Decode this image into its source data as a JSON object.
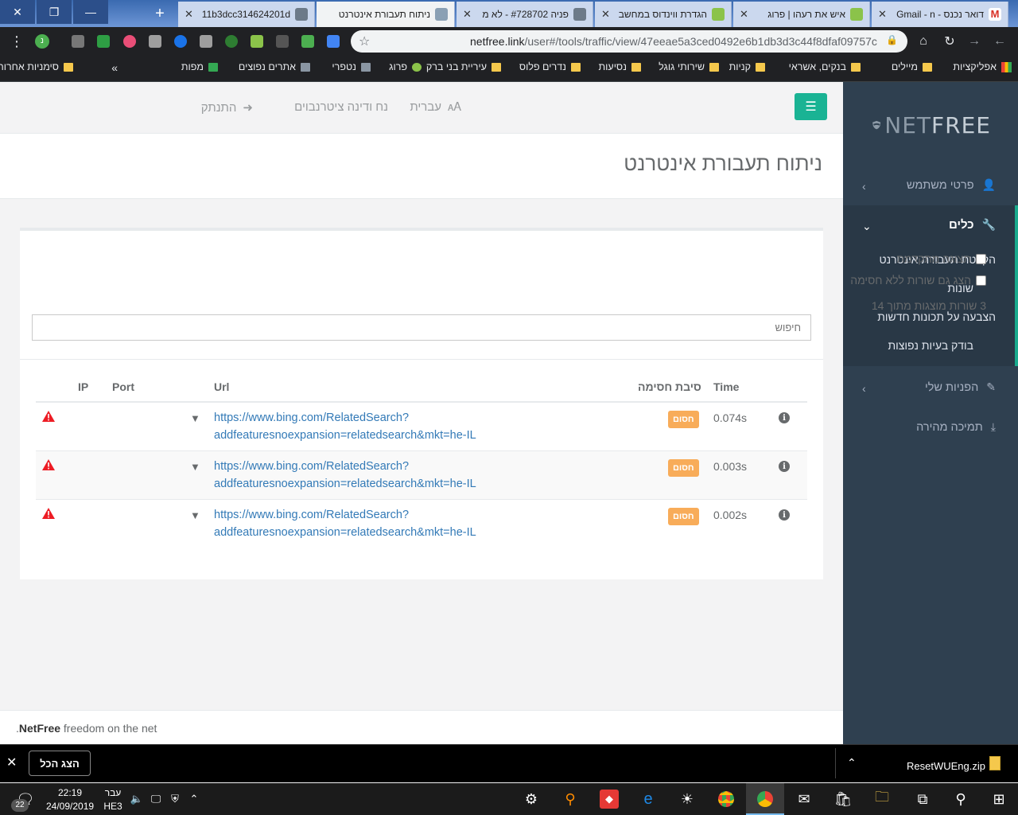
{
  "browser": {
    "tabs": [
      {
        "title": "11b3dcc314624201d",
        "active": false
      },
      {
        "title": "ניתוח תעבורת אינטרנט",
        "active": true
      },
      {
        "title": "פניה #728702 - לא מ",
        "active": false
      },
      {
        "title": "הגדרת ווינדוס במחשב",
        "active": false
      },
      {
        "title": "איש את רעהו | פרוג",
        "active": false
      },
      {
        "title": "דואר נכנס - Gmail - n",
        "active": false
      }
    ],
    "url_host": "netfree.link",
    "url_path": "/user#/tools/traffic/view/47eeae5a3ced0492e6b1db3d3c44f8dfaf09757c",
    "bookmarks": [
      "אפליקציות",
      "מיילים",
      "בנקים, אשראי",
      "קניות",
      "שירותי גוגל",
      "נסיעות",
      "נדרים פלוס",
      "עיריית בני ברק",
      "פרוג",
      "נטפרי",
      "אתרים נפוצים",
      "מפות"
    ],
    "bookmarks_overflow": "»",
    "other_bookmarks": "סימניות אחרות"
  },
  "sidebar": {
    "logo_net": "NET",
    "logo_free": "FREE",
    "items": [
      {
        "label": "פרטי משתמש"
      },
      {
        "label": "כלים"
      },
      {
        "label": "הפניות שלי"
      },
      {
        "label": "תמיכה מהירה"
      }
    ],
    "sub_items": [
      "הקלטת תעבורת אינטרנט",
      "שונות",
      "הצבעה על תכונות חדשות",
      "בודק בעיות נפוצות"
    ]
  },
  "topnav": {
    "language": "עברית",
    "user": "נח ודינה ציטרנבוים",
    "logout": "התנתק"
  },
  "page": {
    "title": "ניתוח תעבורת אינטרנט",
    "advanced_view": "תצוגה מתקדמת",
    "show_unblocked": "הצג גם שורות ללא חסימה",
    "rows_count": "3 שורות מוצגות מתוך 14",
    "search_placeholder": "חיפוש",
    "columns": {
      "time": "Time",
      "reason": "סיבת חסימה",
      "url": "Url",
      "port": "Port",
      "ip": "IP"
    },
    "rows": [
      {
        "time": "0.074s",
        "reason": "חסום",
        "url_line1": "https://www.bing.com/RelatedSearch?",
        "url_line2": "addfeaturesnoexpansion=relatedsearch&mkt=he-IL"
      },
      {
        "time": "0.003s",
        "reason": "חסום",
        "url_line1": "https://www.bing.com/RelatedSearch?",
        "url_line2": "addfeaturesnoexpansion=relatedsearch&mkt=he-IL"
      },
      {
        "time": "0.002s",
        "reason": "חסום",
        "url_line1": "https://www.bing.com/RelatedSearch?",
        "url_line2": "addfeaturesnoexpansion=relatedsearch&mkt=he-IL"
      }
    ]
  },
  "footer": {
    "brand": "NetFree",
    "tagline": "freedom on the net",
    "dot": "."
  },
  "downloads": {
    "show_all": "הצג הכל",
    "file": "ResetWUEng.zip"
  },
  "taskbar": {
    "time": "22:19",
    "date": "24/09/2019",
    "lang1": "עבר",
    "lang2": "HE3",
    "notifications": "22"
  },
  "colors": {
    "accent": "#1ab394",
    "sidebar": "#2f4050",
    "badge": "#f8ac59",
    "link": "#337ab7",
    "danger": "#ed1c24"
  }
}
